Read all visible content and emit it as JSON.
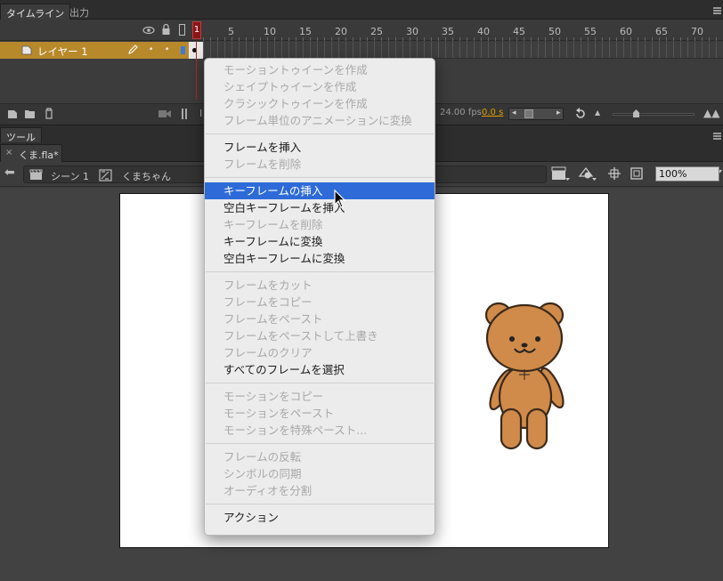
{
  "timeline": {
    "tabs": [
      "タイムライン",
      "出力"
    ],
    "frame_numbers": [
      "1",
      "5",
      "10",
      "15",
      "20",
      "25",
      "30",
      "35",
      "40",
      "45",
      "50",
      "55",
      "60",
      "65",
      "70"
    ],
    "layer_name": "レイヤー 1",
    "fps": "24.00 fps",
    "time": "0.0 s"
  },
  "tools_tab": "ツール",
  "document_tab": "くま.fla*",
  "breadcrumb": {
    "scene": "シーン 1",
    "symbol": "くまちゃん"
  },
  "zoom": "100%",
  "context_menu": {
    "groups": [
      [
        {
          "label": "モーショントゥイーンを作成",
          "enabled": false
        },
        {
          "label": "シェイプトゥイーンを作成",
          "enabled": false
        },
        {
          "label": "クラシックトゥイーンを作成",
          "enabled": false
        },
        {
          "label": "フレーム単位のアニメーションに変換",
          "enabled": false
        }
      ],
      [
        {
          "label": "フレームを挿入",
          "enabled": true
        },
        {
          "label": "フレームを削除",
          "enabled": false
        }
      ],
      [
        {
          "label": "キーフレームの挿入",
          "enabled": true,
          "highlighted": true
        },
        {
          "label": "空白キーフレームを挿入",
          "enabled": true
        },
        {
          "label": "キーフレームを削除",
          "enabled": false
        },
        {
          "label": "キーフレームに変換",
          "enabled": true
        },
        {
          "label": "空白キーフレームに変換",
          "enabled": true
        }
      ],
      [
        {
          "label": "フレームをカット",
          "enabled": false
        },
        {
          "label": "フレームをコピー",
          "enabled": false
        },
        {
          "label": "フレームをペースト",
          "enabled": false
        },
        {
          "label": "フレームをペーストして上書き",
          "enabled": false
        },
        {
          "label": "フレームのクリア",
          "enabled": false
        },
        {
          "label": "すべてのフレームを選択",
          "enabled": true
        }
      ],
      [
        {
          "label": "モーションをコピー",
          "enabled": false
        },
        {
          "label": "モーションをペースト",
          "enabled": false
        },
        {
          "label": "モーションを特殊ペースト...",
          "enabled": false
        }
      ],
      [
        {
          "label": "フレームの反転",
          "enabled": false
        },
        {
          "label": "シンボルの同期",
          "enabled": false
        },
        {
          "label": "オーディオを分割",
          "enabled": false
        }
      ],
      [
        {
          "label": "アクション",
          "enabled": true
        }
      ]
    ]
  },
  "colors": {
    "layer_highlight": "#b8892b",
    "menu_highlight": "#2e6bd9",
    "playhead": "#b52626",
    "bear_fill": "#d08a4a",
    "bear_outline": "#3a2a1a"
  }
}
